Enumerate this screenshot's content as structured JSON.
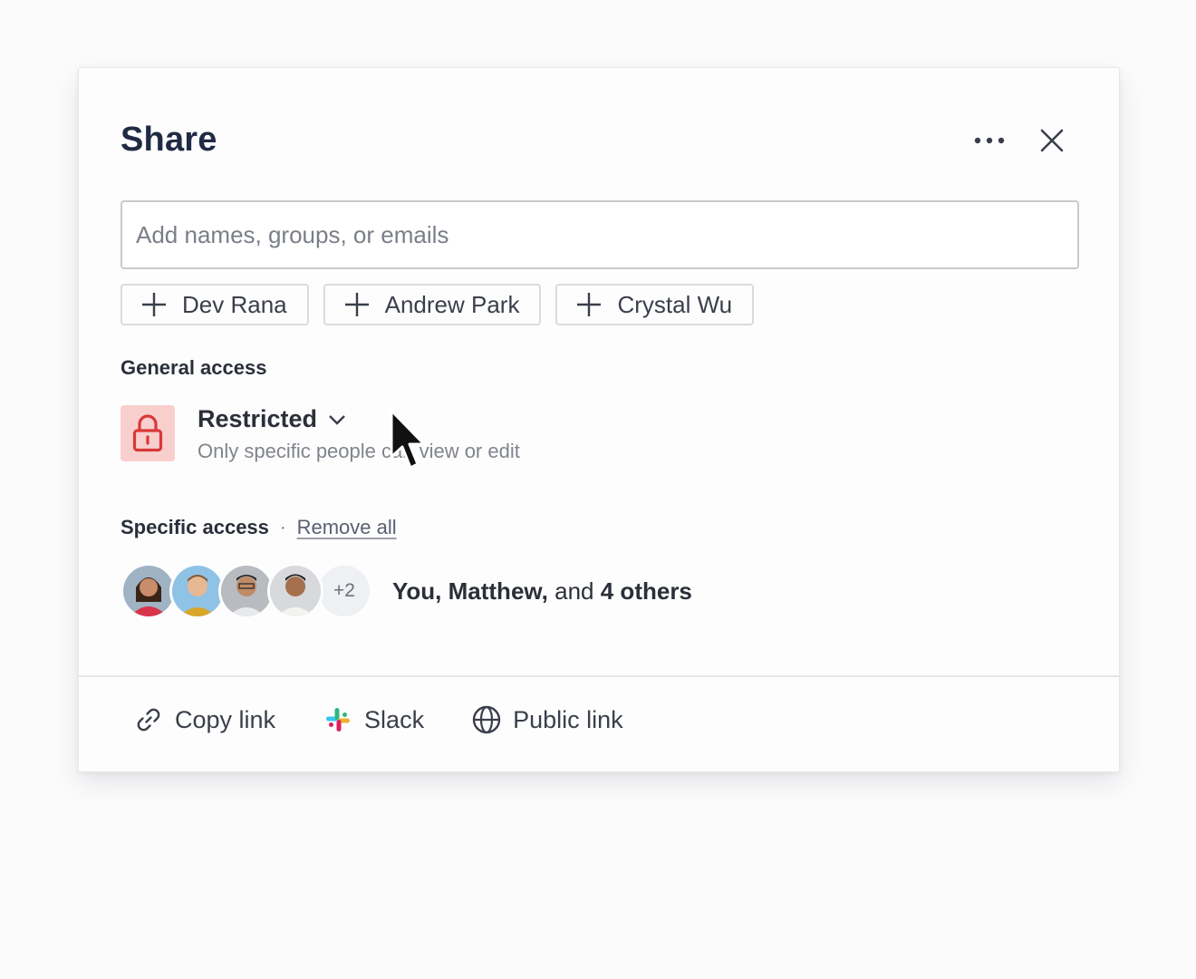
{
  "dialog": {
    "title": "Share",
    "more_icon": "more-horizontal-icon",
    "close_icon": "close-icon"
  },
  "search": {
    "placeholder": "Add names, groups, or emails",
    "value": ""
  },
  "suggestions": [
    {
      "label": "Dev Rana"
    },
    {
      "label": "Andrew Park"
    },
    {
      "label": "Crystal Wu"
    }
  ],
  "general_access": {
    "label": "General access",
    "icon": "lock-icon",
    "level": "Restricted",
    "description": "Only specific people can view or edit",
    "colors": {
      "tile_bg": "#f8cfcd",
      "icon": "#d9383a"
    }
  },
  "specific_access": {
    "label": "Specific access",
    "separator": "·",
    "remove_all": "Remove all",
    "more_count": "+2",
    "summary_part1": "You, Matthew,",
    "summary_part2": "and",
    "summary_part3": "4 others"
  },
  "footer": {
    "copy_link": "Copy link",
    "slack": "Slack",
    "public_link": "Public link"
  }
}
